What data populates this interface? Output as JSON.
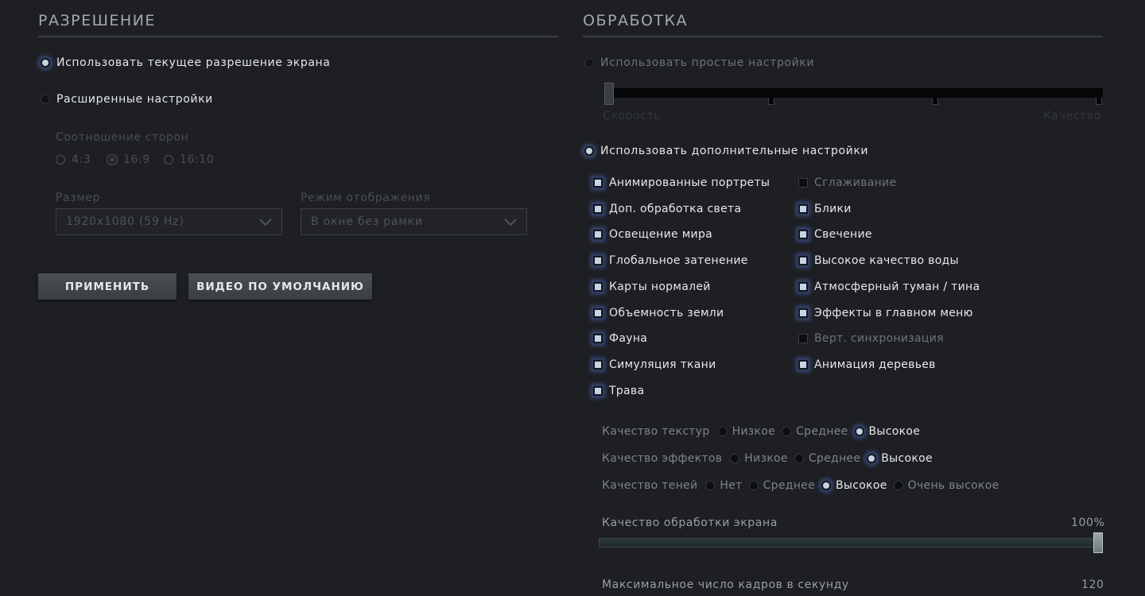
{
  "resolution": {
    "title": "РАЗРЕШЕНИЕ",
    "use_current": "Использовать текущее разрешение экрана",
    "advanced": "Расширенные настройки",
    "aspect_label": "Соотношение сторон",
    "aspects": [
      "4:3",
      "16:9",
      "16:10"
    ],
    "aspect_selected": "16:9",
    "size_label": "Размер",
    "size_value": "1920x1080 (59 Hz)",
    "display_mode_label": "Режим отображения",
    "display_mode_value": "В окне без рамки",
    "apply_button": "ПРИМЕНИТЬ",
    "default_button": "ВИДЕО ПО УМОЛЧАНИЮ"
  },
  "rendering": {
    "title": "ОБРАБОТКА",
    "simple": "Использовать простые настройки",
    "speed": "Скорость",
    "quality": "Качество",
    "advanced": "Использовать дополнительные настройки",
    "checkboxes_left": [
      {
        "label": "Анимированные портреты",
        "checked": true
      },
      {
        "label": "Доп. обработка света",
        "checked": true
      },
      {
        "label": "Освещение мира",
        "checked": true
      },
      {
        "label": "Глобальное затенение",
        "checked": true
      },
      {
        "label": "Карты нормалей",
        "checked": true
      },
      {
        "label": "Объемность земли",
        "checked": true
      },
      {
        "label": "Фауна",
        "checked": true
      },
      {
        "label": "Симуляция ткани",
        "checked": true
      },
      {
        "label": "Трава",
        "checked": true
      }
    ],
    "checkboxes_right": [
      {
        "label": "Сглаживание",
        "checked": false
      },
      {
        "label": "Блики",
        "checked": true
      },
      {
        "label": "Свечение",
        "checked": true
      },
      {
        "label": "Высокое качество воды",
        "checked": true
      },
      {
        "label": "Атмосферный туман / тина",
        "checked": true
      },
      {
        "label": "Эффекты в главном меню",
        "checked": true
      },
      {
        "label": "Верт. синхронизация",
        "checked": false
      },
      {
        "label": "Анимация деревьев",
        "checked": true
      }
    ],
    "texture_quality": {
      "label": "Качество текстур",
      "options": [
        "Низкое",
        "Среднее",
        "Высокое"
      ],
      "selected": "Высокое"
    },
    "effects_quality": {
      "label": "Качество эффектов",
      "options": [
        "Низкое",
        "Среднее",
        "Высокое"
      ],
      "selected": "Высокое"
    },
    "shadow_quality": {
      "label": "Качество теней",
      "options": [
        "Нет",
        "Среднее",
        "Высокое",
        "Очень высокое"
      ],
      "selected": "Высокое"
    },
    "screen_render": {
      "label": "Качество обработки экрана",
      "value_text": "100%",
      "fraction": 1.0
    },
    "max_fps": {
      "label": "Максимальное число кадров в секунду",
      "value_text": "120"
    }
  },
  "colors": {
    "background": "#1d1f22",
    "accent_glow": "#5a6ec8"
  }
}
